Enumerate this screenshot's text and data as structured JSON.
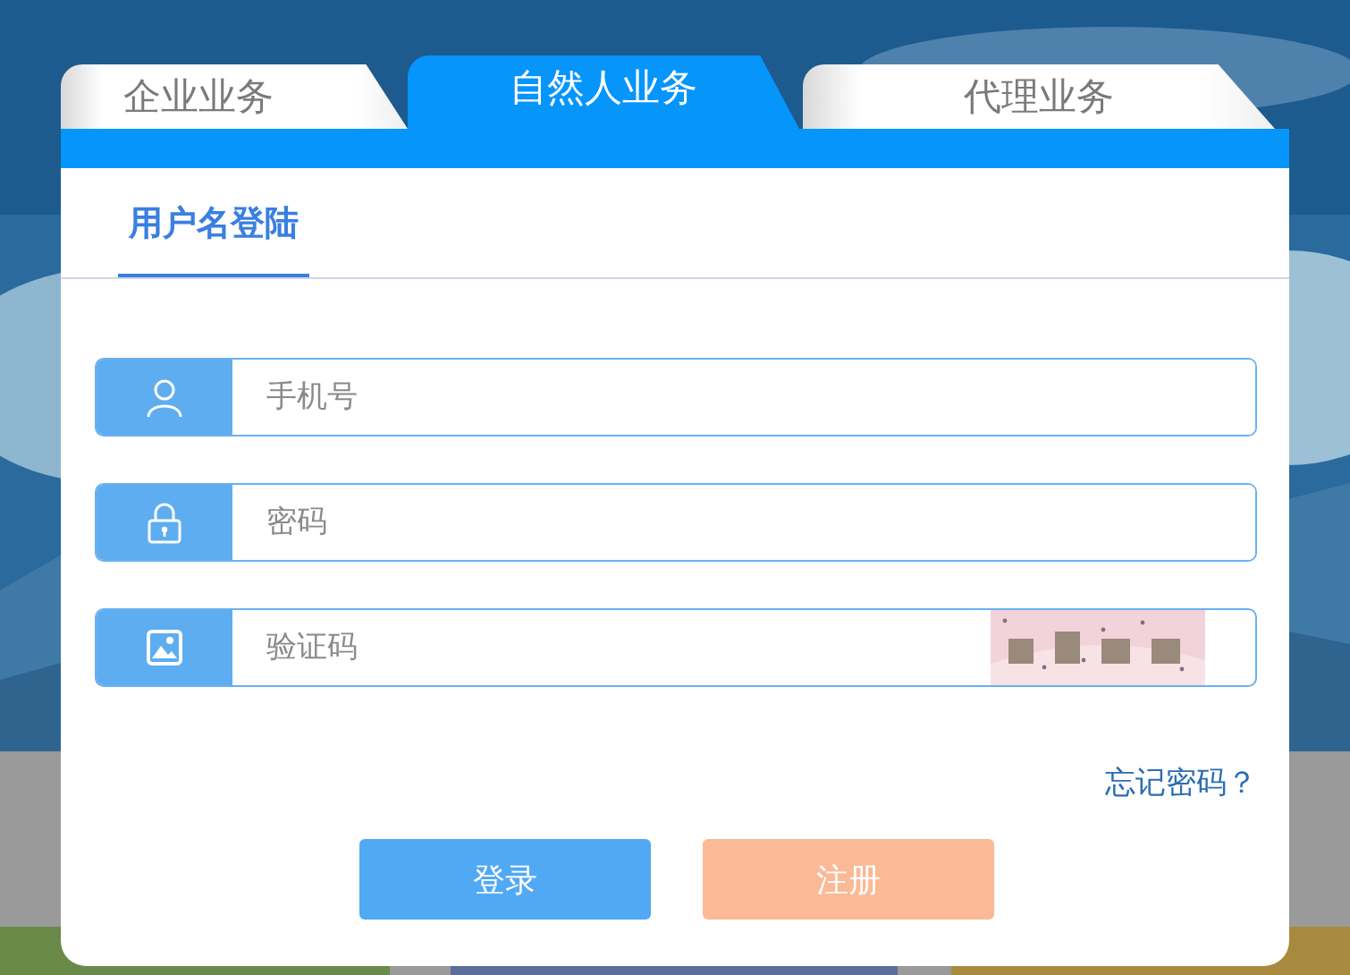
{
  "tabs": [
    {
      "label": "企业业务",
      "selected": false
    },
    {
      "label": "自然人业务",
      "selected": true
    },
    {
      "label": "代理业务",
      "selected": false
    }
  ],
  "login_tabs": [
    {
      "label": "用户名登陆",
      "selected": true
    }
  ],
  "fields": [
    {
      "kind": "user",
      "placeholder": "手机号"
    },
    {
      "kind": "password",
      "placeholder": "密码"
    },
    {
      "kind": "captcha",
      "placeholder": "验证码"
    }
  ],
  "forgot_link": "忘记密码？",
  "buttons": [
    {
      "kind": "primary",
      "label": "登录"
    },
    {
      "kind": "secondary",
      "label": "注册"
    }
  ]
}
